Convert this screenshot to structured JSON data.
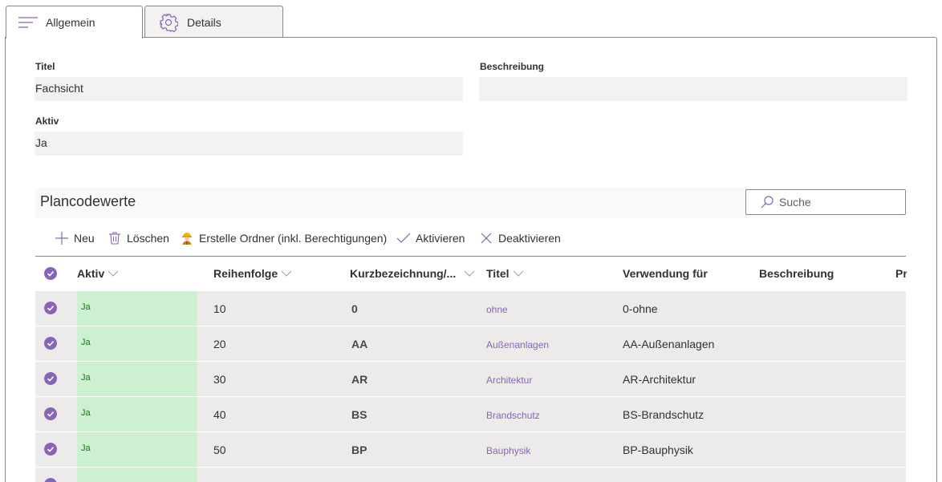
{
  "tabs": [
    {
      "label": "Allgemein",
      "icon": "menu-lines-icon",
      "active": true
    },
    {
      "label": "Details",
      "icon": "gear-icon",
      "active": false
    }
  ],
  "fields": {
    "titel": {
      "label": "Titel",
      "value": "Fachsicht"
    },
    "beschreibung": {
      "label": "Beschreibung",
      "value": ""
    },
    "aktiv": {
      "label": "Aktiv",
      "value": "Ja"
    }
  },
  "list": {
    "title": "Plancodewerte",
    "search_placeholder": "Suche",
    "commands": {
      "new": "Neu",
      "delete": "Löschen",
      "create_folder": "Erstelle Ordner (inkl. Berechtigungen)",
      "activate": "Aktivieren",
      "deactivate": "Deaktivieren"
    },
    "columns": {
      "aktiv": "Aktiv",
      "reihenfolge": "Reihenfolge",
      "kurz": "Kurzbezeichnung/...",
      "titel": "Titel",
      "verwendung": "Verwendung für",
      "beschreibung": "Beschreibung",
      "pr": "Pr"
    },
    "rows": [
      {
        "aktiv": "Ja",
        "reihenfolge": "10",
        "kurz": "0",
        "titel": "ohne",
        "verwendung": "0-ohne"
      },
      {
        "aktiv": "Ja",
        "reihenfolge": "20",
        "kurz": "AA",
        "titel": "Außenanlagen",
        "verwendung": "AA-Außenanlagen"
      },
      {
        "aktiv": "Ja",
        "reihenfolge": "30",
        "kurz": "AR",
        "titel": "Architektur",
        "verwendung": "AR-Architektur"
      },
      {
        "aktiv": "Ja",
        "reihenfolge": "40",
        "kurz": "BS",
        "titel": "Brandschutz",
        "verwendung": "BS-Brandschutz"
      },
      {
        "aktiv": "Ja",
        "reihenfolge": "50",
        "kurz": "BP",
        "titel": "Bauphysik",
        "verwendung": "BP-Bauphysik"
      }
    ]
  },
  "colors": {
    "accent": "#8764b8",
    "active_cell": "#cdf0d0",
    "active_text": "#107c10",
    "row_bg": "#edebe9"
  }
}
